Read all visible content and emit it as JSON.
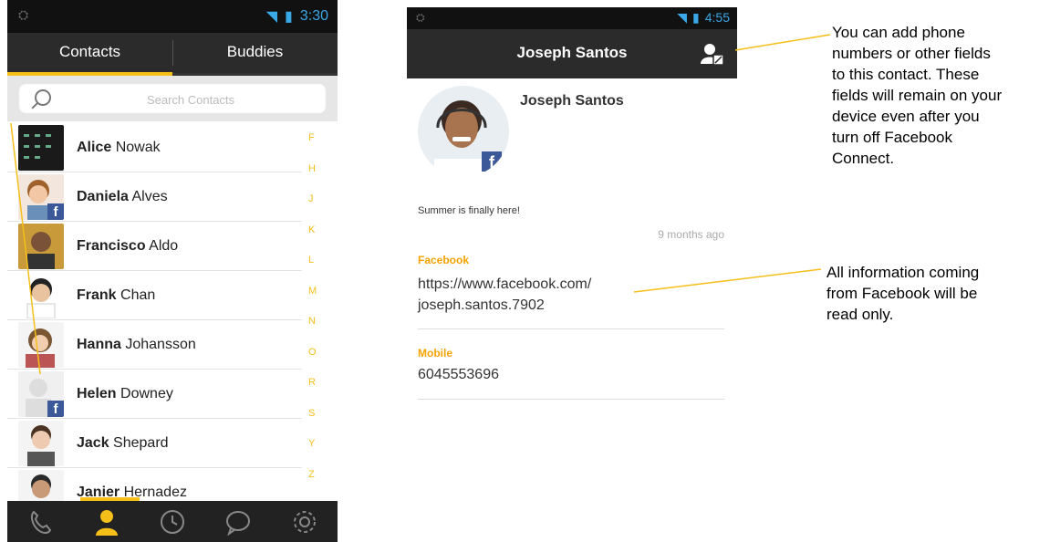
{
  "left_phone": {
    "status_time": "3:30",
    "tabs": [
      {
        "label": "Contacts",
        "active": true
      },
      {
        "label": "Buddies",
        "active": false
      }
    ],
    "search": {
      "placeholder": "Search Contacts"
    },
    "contacts": [
      {
        "first": "Alice",
        "last": "Nowak",
        "facebook": false
      },
      {
        "first": "Daniela",
        "last": "Alves",
        "facebook": true
      },
      {
        "first": "Francisco",
        "last": "Aldo",
        "facebook": false
      },
      {
        "first": "Frank",
        "last": "Chan",
        "facebook": false
      },
      {
        "first": "Hanna",
        "last": "Johansson",
        "facebook": false
      },
      {
        "first": "Helen",
        "last": "Downey",
        "facebook": true
      },
      {
        "first": "Jack",
        "last": "Shepard",
        "facebook": false
      },
      {
        "first": "Janier",
        "last": "Hernadez",
        "facebook": false
      }
    ],
    "alphabet": [
      "F",
      "H",
      "J",
      "K",
      "L",
      "M",
      "N",
      "O",
      "R",
      "S",
      "Y",
      "Z"
    ],
    "bottom_nav": [
      "phone-icon",
      "contacts-icon",
      "history-icon",
      "chat-icon",
      "settings-icon"
    ],
    "accent": "#f5bf1a"
  },
  "right_phone": {
    "status_time": "4:55",
    "title": "Joseph Santos",
    "name": "Joseph Santos",
    "status_message": "Summer is finally here!",
    "status_time_ago": "9 months ago",
    "fields": [
      {
        "label": "Facebook",
        "value_line1": "https://www.facebook.com/",
        "value_line2": "joseph.santos.7902"
      },
      {
        "label": "Mobile",
        "value_line1": "6045553696"
      }
    ]
  },
  "callouts": {
    "top": [
      "You can add phone",
      "numbers or other fields",
      "to this contact.  These",
      "fields will remain on your",
      "device even after you",
      "turn off Facebook",
      "Connect."
    ],
    "bottom": [
      "All information coming",
      "from Facebook will be",
      "read only."
    ]
  },
  "fb_letter": "f"
}
